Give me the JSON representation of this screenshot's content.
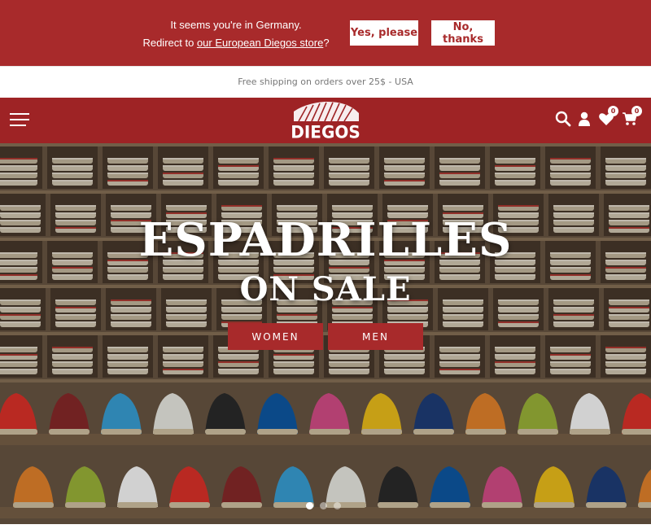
{
  "geo_banner": {
    "line1": "It seems you're in Germany.",
    "line2_prefix": "Redirect to ",
    "link_text": "our European Diegos store",
    "line2_suffix": "?",
    "yes_label": "Yes, please",
    "no_label": "No, thanks"
  },
  "announcement": "Free shipping on orders over 25$ - USA",
  "header": {
    "logo_text": "DIEGOS",
    "wishlist_count": "0",
    "cart_count": "0",
    "icons": [
      "menu-icon",
      "search-icon",
      "user-icon",
      "heart-icon",
      "cart-icon"
    ]
  },
  "hero": {
    "title": "ESPADRILLES",
    "subtitle": "ON SALE",
    "buttons": [
      "WOMEN",
      "MEN"
    ],
    "slides": 3,
    "active_slide": 1
  },
  "colors": {
    "brand_red": "#a82a2b",
    "header_red": "#9e2325",
    "white": "#ffffff"
  }
}
